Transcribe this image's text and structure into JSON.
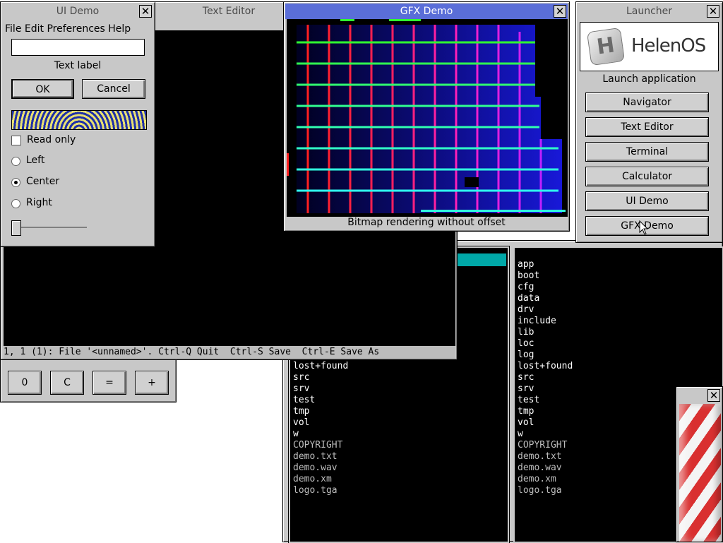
{
  "ui_demo": {
    "title": "UI Demo",
    "menu": [
      "File",
      "Edit",
      "Preferences",
      "Help"
    ],
    "entry_value": "",
    "text_label": "Text label",
    "ok_label": "OK",
    "cancel_label": "Cancel",
    "checkbox_label": "Read only",
    "checkbox_checked": false,
    "radio_left": "Left",
    "radio_center": "Center",
    "radio_right": "Right",
    "radio_selected": "Center",
    "slider_value": 0
  },
  "text_editor": {
    "title": "Text Editor",
    "status": "1, 1 (1): File '<unnamed>'. Ctrl-Q Quit  Ctrl-S Save  Ctrl-E Save As"
  },
  "gfx_demo": {
    "title": "GFX Demo",
    "caption": "Bitmap rendering without offset"
  },
  "launcher": {
    "title": "Launcher",
    "logo_text": "HelenOS",
    "logo_letter": "H",
    "heading": "Launch application",
    "buttons": [
      "Navigator",
      "Text Editor",
      "Terminal",
      "Calculator",
      "UI Demo",
      "GFX Demo"
    ]
  },
  "calculator": {
    "buttons": [
      "0",
      "C",
      "=",
      "+"
    ]
  },
  "navigator_left": {
    "items": [
      "lost+found",
      "src",
      "srv",
      "test",
      "tmp",
      "vol",
      "w",
      "COPYRIGHT",
      "demo.txt",
      "demo.wav",
      "demo.xm",
      "logo.tga"
    ]
  },
  "navigator_right": {
    "items": [
      "app",
      "boot",
      "cfg",
      "data",
      "drv",
      "include",
      "lib",
      "loc",
      "log",
      "lost+found",
      "src",
      "srv",
      "test",
      "tmp",
      "vol",
      "w",
      "COPYRIGHT",
      "demo.txt",
      "demo.wav",
      "demo.xm",
      "logo.tga"
    ]
  },
  "barber": {
    "close": "✕"
  },
  "colors": {
    "title_active": "#5a6ed8",
    "selection": "#00a8a8",
    "window": "#c8c8c8"
  }
}
